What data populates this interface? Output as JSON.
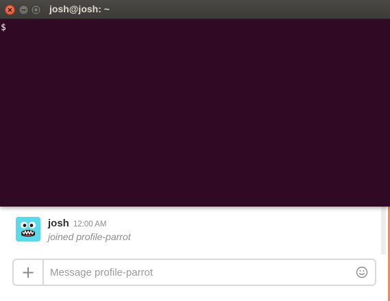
{
  "terminal": {
    "title": "josh@josh: ~",
    "prompt": "$",
    "background_color": "#300a24"
  },
  "message": {
    "username": "josh",
    "timestamp": "12:00 AM",
    "text": "joined profile-parrot",
    "avatar": "monster-avatar"
  },
  "composer": {
    "placeholder": "Message profile-parrot",
    "add_icon": "plus-icon",
    "emoji_icon": "smiley-icon"
  },
  "colors": {
    "accent_strip": "#e08e6a",
    "avatar_bg": "#5bd8ea",
    "titlebar": "#3c3b37",
    "close_button": "#df4b1f"
  }
}
